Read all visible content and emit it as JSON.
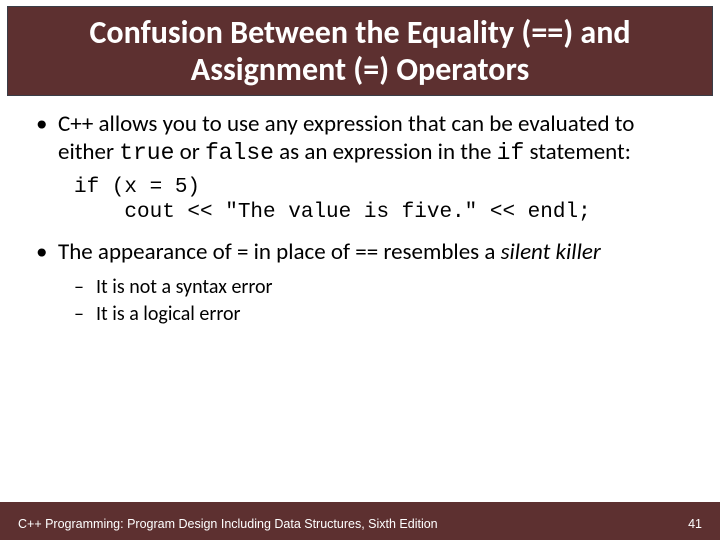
{
  "title": "Confusion Between the Equality (==) and Assignment (=) Operators",
  "bullets": [
    {
      "pre": "C++ allows you to use any expression that can be evaluated to either ",
      "code1": "true",
      "mid1": " or ",
      "code2": "false",
      "mid2": " as an expression in the ",
      "code3": "if",
      "post": " statement:"
    },
    {
      "pre": "The appearance of = in place of == resembles a ",
      "em": "silent killer"
    }
  ],
  "code": "if (x = 5)\n    cout << \"The value is five.\" << endl;",
  "sub_bullets": [
    "It is not a syntax error",
    "It is a logical error"
  ],
  "footer": {
    "book": "C++ Programming: Program Design Including Data Structures, Sixth Edition",
    "page": "41"
  }
}
